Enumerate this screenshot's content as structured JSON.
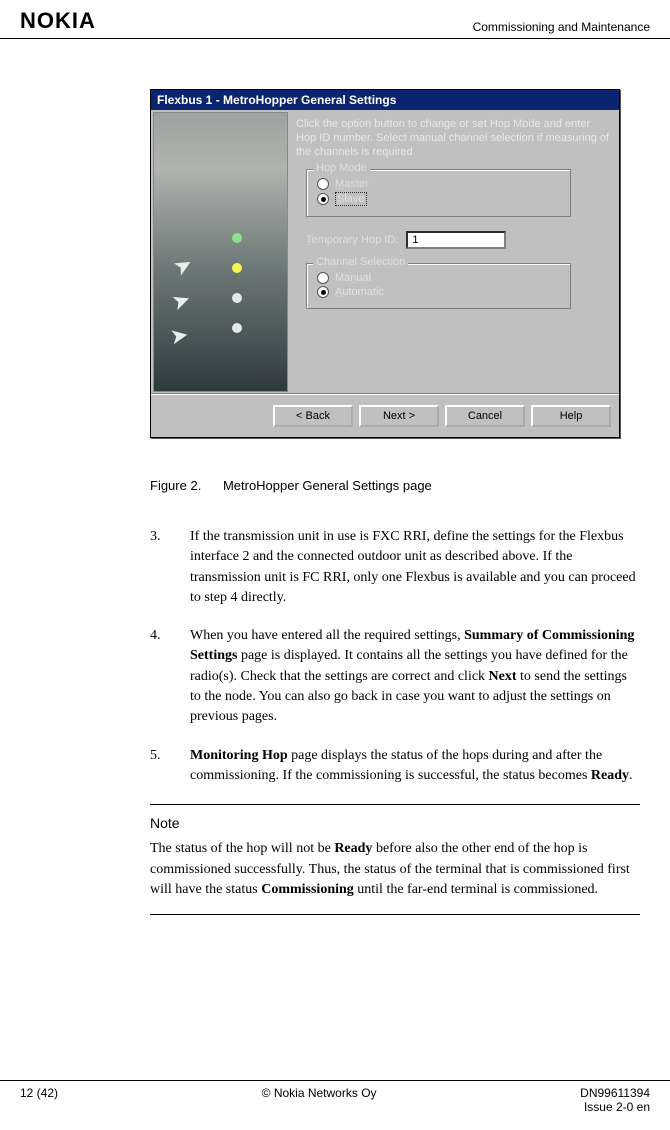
{
  "header": {
    "logo": "NOKIA",
    "section": "Commissioning and Maintenance"
  },
  "dialog": {
    "title": "Flexbus 1 - MetroHopper General Settings",
    "instruction": "Click the option button to change or set Hop Mode and enter Hop ID number. Select manual channel selection if measuring of the channels is required.",
    "hopmode_legend": "Hop Mode",
    "hopmode_master": "Master",
    "hopmode_slave": "Slave",
    "hopid_label": "Temporary Hop ID:",
    "hopid_value": "1",
    "chansel_legend": "Channel Selection",
    "chansel_manual": "Manual",
    "chansel_auto": "Automatic",
    "btn_back": "< Back",
    "btn_next": "Next >",
    "btn_cancel": "Cancel",
    "btn_help": "Help"
  },
  "figure": {
    "num": "Figure 2.",
    "caption": "MetroHopper General Settings page"
  },
  "steps": {
    "s3num": "3.",
    "s3": "If the transmission unit in use is FXC RRI, define the settings for the Flexbus interface 2 and the connected outdoor unit as described above. If the transmission unit is FC RRI, only one Flexbus is available and you can proceed to step 4 directly.",
    "s4num": "4.",
    "s4a": "When you have entered all the required settings, ",
    "s4b": "Summary of Commissioning Settings",
    "s4c": " page is displayed. It contains all the settings you have defined for the radio(s). Check that the settings are correct and click ",
    "s4d": "Next",
    "s4e": " to send the settings to the node. You can also go back in case you want to adjust the settings on previous pages.",
    "s5num": "5.",
    "s5a": "Monitoring Hop",
    "s5b": " page displays the status of the hops during and after the commissioning. If the commissioning is successful, the status becomes ",
    "s5c": "Ready",
    "s5d": "."
  },
  "note": {
    "title": "Note",
    "a": "The status of the hop will not be ",
    "b": "Ready",
    "c": " before also the other end of the hop is commissioned successfully. Thus, the status of the terminal that is commissioned first will have the status ",
    "d": "Commissioning",
    "e": " until the far-end terminal is commissioned."
  },
  "footer": {
    "page": "12 (42)",
    "copyright": "© Nokia Networks Oy",
    "doc": "DN99611394",
    "issue": "Issue 2-0 en"
  }
}
